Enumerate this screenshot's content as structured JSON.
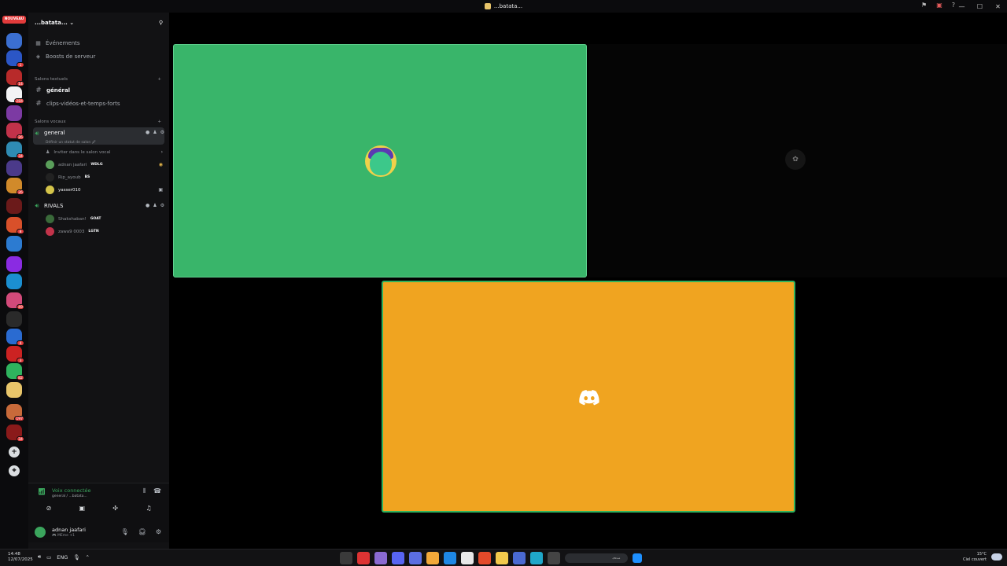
{
  "window": {
    "title": "...batata...",
    "controls": [
      "—",
      "☐",
      "✕"
    ]
  },
  "rail": {
    "new_badge": "NOUVEAU",
    "servers": [
      {
        "color": "#3b6fd1",
        "badge": ""
      },
      {
        "color": "#2b56c6",
        "badge": "1"
      },
      {
        "color": "#b82a2a",
        "badge": "14"
      },
      {
        "color": "#f2f3f5",
        "badge": "284"
      },
      {
        "color": "#7c3aa3",
        "badge": ""
      },
      {
        "color": "#c1324a",
        "badge": "26"
      },
      {
        "color": "#2f8bb3",
        "badge": "34"
      },
      {
        "color": "#4b3a8a",
        "badge": ""
      },
      {
        "color": "#d18a2a",
        "badge": "26"
      },
      {
        "color": "#6b1a1a",
        "badge": ""
      },
      {
        "color": "#d9502a",
        "badge": "8"
      },
      {
        "color": "#2c7bd1",
        "badge": ""
      },
      {
        "color": "#8a2be2",
        "badge": ""
      },
      {
        "color": "#1b8fd1",
        "badge": ""
      },
      {
        "color": "#d24a7a",
        "badge": "49"
      },
      {
        "color": "#2a2a2a",
        "badge": ""
      },
      {
        "color": "#2a6bd1",
        "badge": "4"
      },
      {
        "color": "#c22",
        "badge": "3"
      },
      {
        "color": "#2fb35e",
        "badge": "82"
      },
      {
        "color": "#e8c56a",
        "badge": ""
      },
      {
        "color": "#c86a3a",
        "badge": "197"
      },
      {
        "color": "#8a1a1a",
        "badge": "34"
      }
    ],
    "add_label": "+",
    "discover_label": "⌖"
  },
  "guild": {
    "name": "...batata...",
    "events_label": "Événements",
    "boosts_label": "Boosts de serveur",
    "text_category": "Salons textuels",
    "text_channels": [
      {
        "name": "général",
        "active": true
      },
      {
        "name": "clips-vidéos-et-temps-forts",
        "active": false
      }
    ],
    "voice_category": "Salons vocaux",
    "voice_channels": [
      {
        "name": "general",
        "status": "Définir un statut de salon 🖉",
        "invite": "Inviter dans le salon vocal",
        "members": [
          {
            "name": "adnan jaafari",
            "tag": "WDLG",
            "color": "#5a9e5a"
          },
          {
            "name": "Rip_ayoub",
            "tag": "BS",
            "color": "#222"
          },
          {
            "name": "yasser010",
            "tag": "",
            "color": "#d4c44a"
          }
        ]
      },
      {
        "name": "RIVALS",
        "members": [
          {
            "name": "Shakshaban!",
            "tag": "GOAT",
            "color": "#3a6a3a"
          },
          {
            "name": "zawa9 0003",
            "tag": "LGTN",
            "color": "#c2334a"
          }
        ]
      }
    ]
  },
  "voice_panel": {
    "title": "Voix connectée",
    "subtitle": "general / ...batata..."
  },
  "user_panel": {
    "name": "adnan jaafari",
    "subtitle": "🎮 MEme +1"
  },
  "stage": {
    "tile1_color": "#39b56a",
    "tile3_color": "#f0a420"
  },
  "taskbar": {
    "time": "14:48",
    "date": "12/07/2025",
    "lang": "ENG",
    "search_text": "ﺚﺤﺑ",
    "temp": "15°C",
    "weather": "Ciel couvert"
  }
}
